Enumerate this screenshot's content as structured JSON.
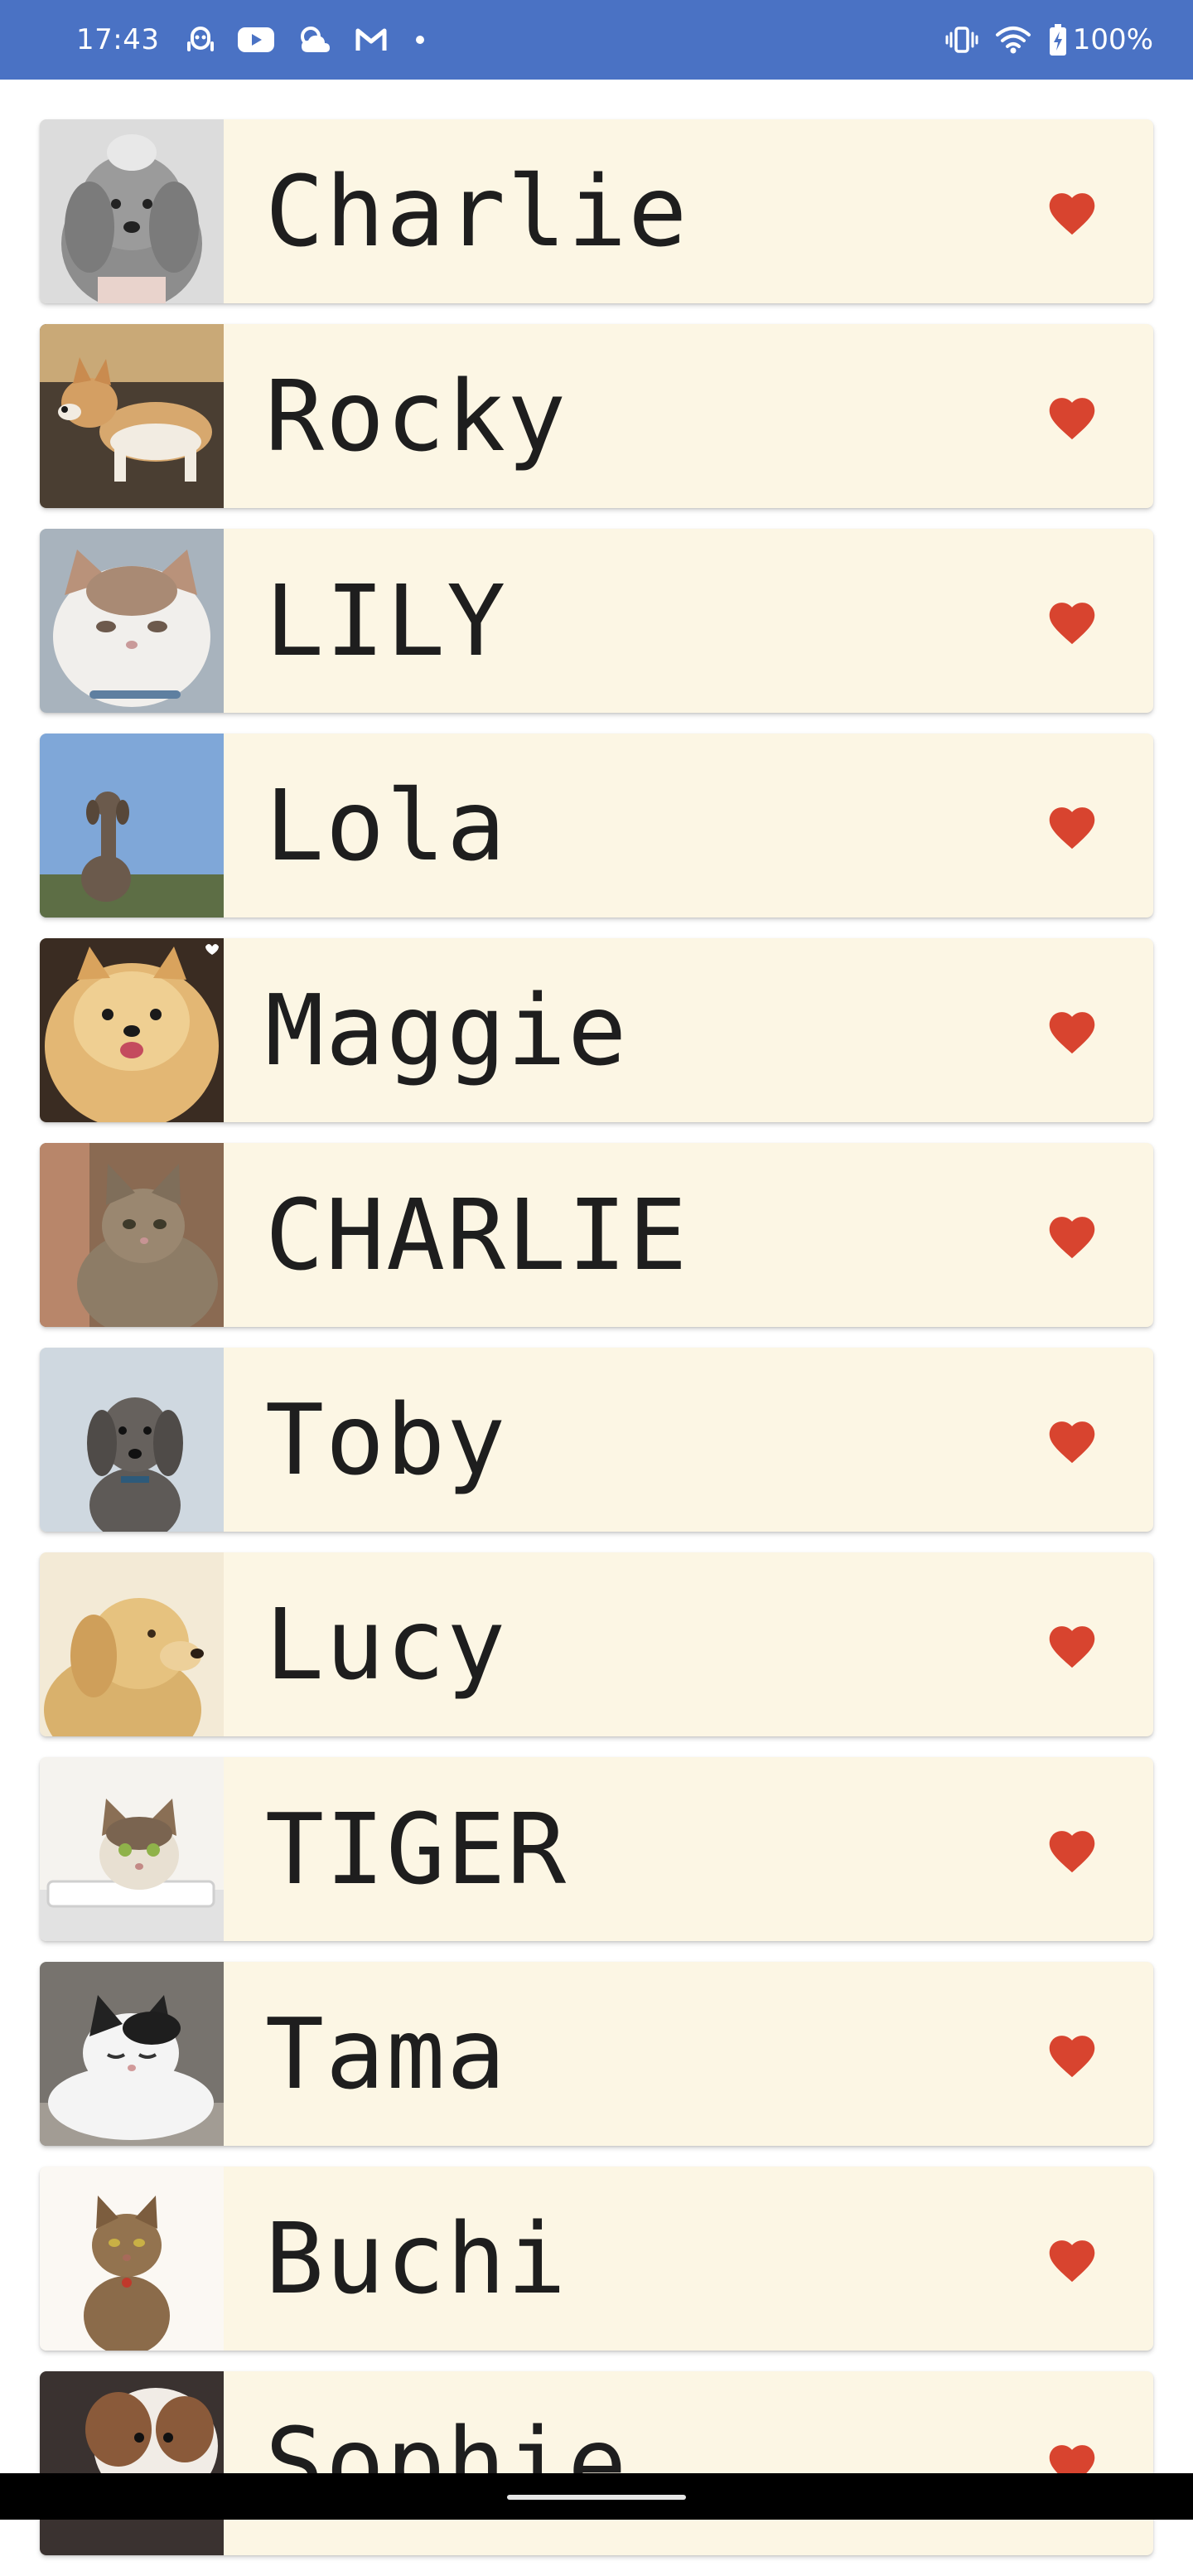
{
  "status_bar": {
    "time": "17:43",
    "icons_left": [
      "assistant-icon",
      "youtube-icon",
      "weather-icon",
      "gmail-icon",
      "notification-dot-icon"
    ],
    "icons_right": [
      "vibrate-icon",
      "wifi-icon",
      "battery-charging-icon"
    ],
    "battery": "100%",
    "background_color": "#4a72c4"
  },
  "list": {
    "card_color": "#fcf6e4",
    "heart_color": "#d8442f",
    "items": [
      {
        "name": "Charlie",
        "photo": "gray poodle",
        "favorite_icon": "heart-icon"
      },
      {
        "name": "Rocky",
        "photo": "corgi",
        "favorite_icon": "heart-icon"
      },
      {
        "name": "LILY",
        "photo": "white exotic cat",
        "favorite_icon": "heart-icon"
      },
      {
        "name": "Lola",
        "photo": "poodle in field",
        "favorite_icon": "heart-icon"
      },
      {
        "name": "Maggie",
        "photo": "pomeranian",
        "favorite_icon": "heart-icon"
      },
      {
        "name": "CHARLIE",
        "photo": "tabby cat",
        "favorite_icon": "heart-icon"
      },
      {
        "name": "Toby",
        "photo": "gray poodle puppy",
        "favorite_icon": "heart-icon"
      },
      {
        "name": "Lucy",
        "photo": "golden retriever",
        "favorite_icon": "heart-icon"
      },
      {
        "name": "TIGER",
        "photo": "cat in box",
        "favorite_icon": "heart-icon"
      },
      {
        "name": "Tama",
        "photo": "black and white cat",
        "favorite_icon": "heart-icon"
      },
      {
        "name": "Buchi",
        "photo": "brown tabby cat",
        "favorite_icon": "heart-icon"
      },
      {
        "name": "Sophie",
        "photo": "shih tzu",
        "favorite_icon": "heart-icon"
      }
    ]
  }
}
